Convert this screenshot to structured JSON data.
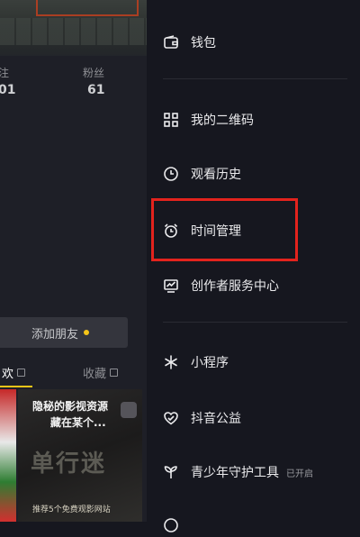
{
  "profile": {
    "stats": [
      {
        "label": "注",
        "value": "01"
      },
      {
        "label": "粉丝",
        "value": "61"
      }
    ],
    "add_friend_label": "添加朋友",
    "tabs": [
      {
        "label": "欢",
        "active": true
      },
      {
        "label": "收藏",
        "active": false
      }
    ],
    "thumbnail": {
      "line1": "隐秘的影视资源",
      "line2": "藏在某个...",
      "big_text": "单行迷",
      "footer": "推荐5个免费观影网站"
    }
  },
  "menu": {
    "items": [
      {
        "label": "钱包",
        "icon": "wallet-icon"
      },
      {
        "label": "我的二维码",
        "icon": "qrcode-icon"
      },
      {
        "label": "观看历史",
        "icon": "clock-icon"
      },
      {
        "label": "时间管理",
        "icon": "alarm-clock-icon"
      },
      {
        "label": "创作者服务中心",
        "icon": "chart-icon"
      },
      {
        "label": "小程序",
        "icon": "asterisk-icon"
      },
      {
        "label": "抖音公益",
        "icon": "heart-hands-icon"
      },
      {
        "label": "青少年守护工具",
        "icon": "sprout-icon",
        "badge": "已开启"
      }
    ]
  },
  "colors": {
    "highlight_box": "#e3231d",
    "accent_yellow": "#f5c518",
    "background": "#16171f"
  }
}
